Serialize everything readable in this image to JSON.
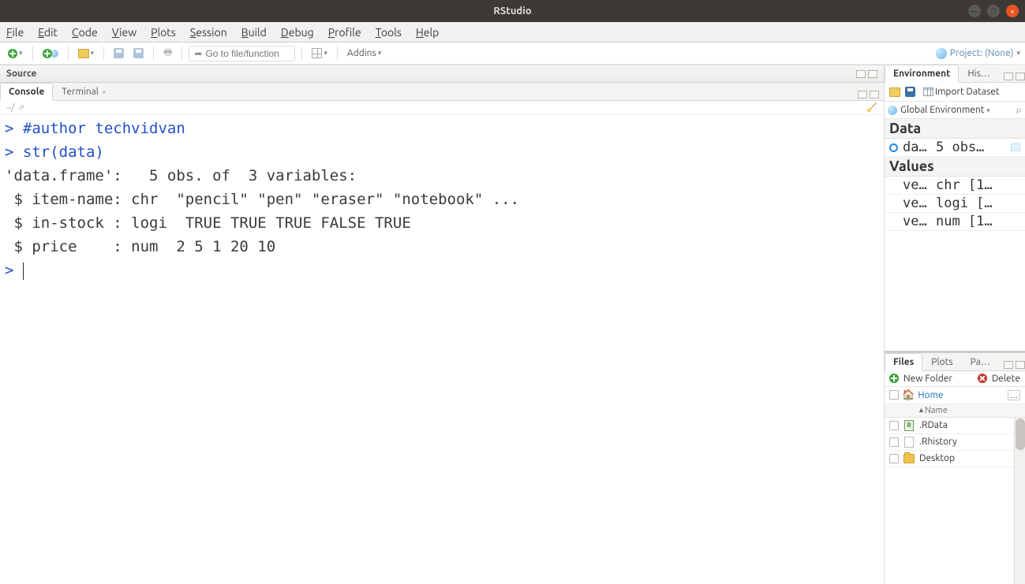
{
  "title": "RStudio",
  "menu": [
    "File",
    "Edit",
    "Code",
    "View",
    "Plots",
    "Session",
    "Build",
    "Debug",
    "Profile",
    "Tools",
    "Help"
  ],
  "toolbar": {
    "goto_placeholder": "Go to file/function",
    "addins": "Addins",
    "project": "Project: (None)"
  },
  "source": {
    "title": "Source"
  },
  "console": {
    "tabs": [
      "Console",
      "Terminal"
    ],
    "active_tab": 0,
    "path": "~/",
    "lines": [
      {
        "type": "cmd",
        "prompt": ">",
        "text": " #author techvidvan"
      },
      {
        "type": "cmd",
        "prompt": ">",
        "text": " str(data)"
      },
      {
        "type": "out",
        "text": "'data.frame':   5 obs. of  3 variables:"
      },
      {
        "type": "out",
        "text": " $ item-name: chr  \"pencil\" \"pen\" \"eraser\" \"notebook\" ..."
      },
      {
        "type": "out",
        "text": " $ in-stock : logi  TRUE TRUE TRUE FALSE TRUE"
      },
      {
        "type": "out",
        "text": " $ price    : num  2 5 1 20 10"
      },
      {
        "type": "cmd",
        "prompt": ">",
        "text": " ",
        "cursor": true
      }
    ]
  },
  "env": {
    "tabs": [
      "Environment",
      "History"
    ],
    "tabs_short": [
      "Environment",
      "His…"
    ],
    "active_tab": 0,
    "import": "Import Dataset",
    "scope": "Global Environment",
    "sections": [
      {
        "title": "Data",
        "rows": [
          {
            "icon": "circle",
            "name": "da…",
            "val": "5 obs…",
            "grid": true
          }
        ]
      },
      {
        "title": "Values",
        "rows": [
          {
            "name": "ve…",
            "val": "chr [1…"
          },
          {
            "name": "ve…",
            "val": "logi […"
          },
          {
            "name": "ve…",
            "val": "num [1…"
          }
        ]
      }
    ]
  },
  "files": {
    "tabs": [
      "Files",
      "Plots",
      "Packages"
    ],
    "tabs_short": [
      "Files",
      "Plots",
      "Pa…"
    ],
    "active_tab": 0,
    "new_folder": "New Folder",
    "delete": "Delete",
    "home": "Home",
    "col_name": "Name",
    "dots": "…",
    "items": [
      {
        "icon": "r",
        "name": ".RData"
      },
      {
        "icon": "page",
        "name": ".Rhistory"
      },
      {
        "icon": "folder",
        "name": "Desktop"
      }
    ]
  }
}
